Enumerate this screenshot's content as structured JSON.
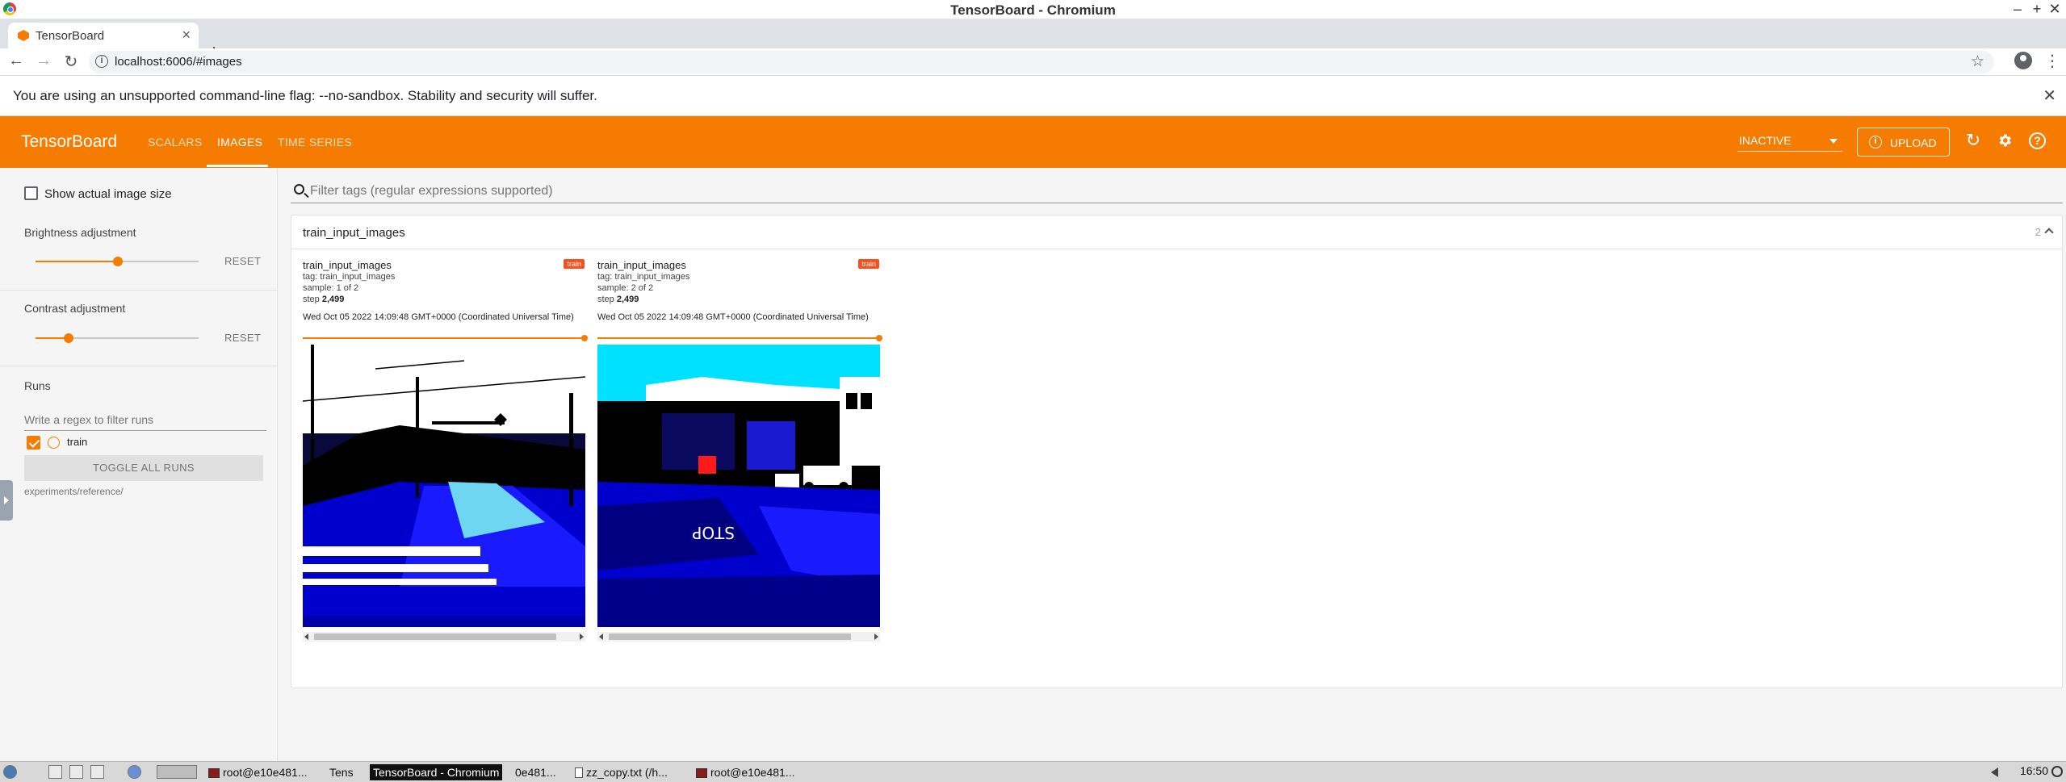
{
  "window": {
    "title": "TensorBoard - Chromium"
  },
  "browser": {
    "tab_title": "TensorBoard",
    "url": "localhost:6006/#images",
    "infobar_message": "You are using an unsupported command-line flag: --no-sandbox. Stability and security will suffer."
  },
  "toolbar": {
    "brand": "TensorBoard",
    "tabs": [
      {
        "label": "SCALARS",
        "active": false
      },
      {
        "label": "IMAGES",
        "active": true
      },
      {
        "label": "TIME SERIES",
        "active": false
      }
    ],
    "status_select": "INACTIVE",
    "upload_label": "UPLOAD",
    "accent_color": "#f57c00"
  },
  "sidebar": {
    "actual_size_label": "Show actual image size",
    "actual_size_checked": false,
    "brightness": {
      "label": "Brightness adjustment",
      "reset": "RESET",
      "level": 0.5
    },
    "contrast": {
      "label": "Contrast adjustment",
      "reset": "RESET",
      "level": 0.2
    },
    "runs": {
      "heading": "Runs",
      "filter_placeholder": "Write a regex to filter runs",
      "items": [
        {
          "name": "train",
          "checked": true
        }
      ],
      "toggle_all": "TOGGLE ALL RUNS",
      "logdir": "experiments/reference/"
    }
  },
  "main": {
    "filter_placeholder": "Filter tags (regular expressions supported)",
    "group": {
      "name": "train_input_images",
      "count": "2",
      "cards": [
        {
          "title": "train_input_images",
          "run_badge": "train",
          "tag": "tag: train_input_images",
          "sample": "sample: 1 of 2",
          "step_label": "step",
          "step_value": "2,499",
          "timestamp": "Wed Oct 05 2022 14:09:48 GMT+0000 (Coordinated Universal Time)"
        },
        {
          "title": "train_input_images",
          "run_badge": "train",
          "tag": "tag: train_input_images",
          "sample": "sample: 2 of 2",
          "step_label": "step",
          "step_value": "2,499",
          "timestamp": "Wed Oct 05 2022 14:09:48 GMT+0000 (Coordinated Universal Time)"
        }
      ]
    }
  },
  "taskbar": {
    "items": [
      "root@e10e481...",
      "Tens",
      "TensorBoard - Chromium",
      "0e481...",
      "zz_copy.txt (/h...",
      "root@e10e481..."
    ],
    "clock": "16:50"
  }
}
